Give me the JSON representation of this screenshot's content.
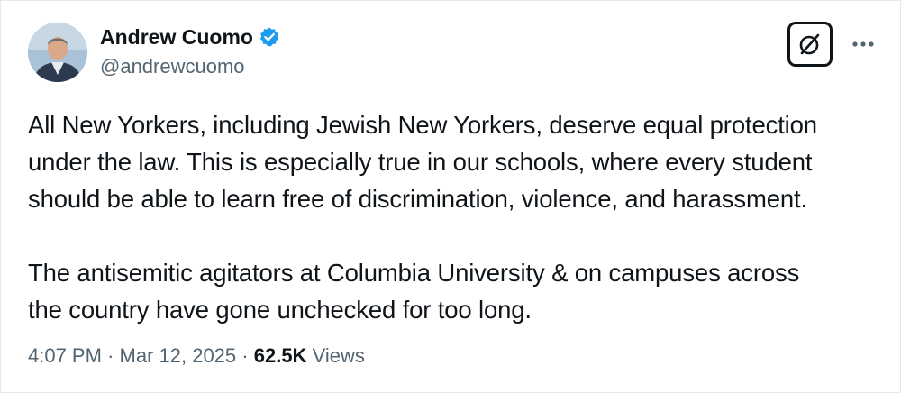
{
  "author": {
    "display_name": "Andrew Cuomo",
    "handle": "@andrewcuomo",
    "verified": true,
    "verified_color": "#1d9bf0"
  },
  "header_actions": {
    "grok_icon": "grok-icon",
    "more_icon": "more-options-icon"
  },
  "tweet": {
    "paragraphs": [
      "All New Yorkers, including Jewish New Yorkers, deserve equal protection\nunder the law. This is especially true in our schools, where every student\nshould be able to learn free of discrimination, violence, and harassment.",
      "The antisemitic agitators at Columbia University & on campuses across\nthe country have gone unchecked for too long."
    ]
  },
  "meta": {
    "time": "4:07 PM",
    "separator": "·",
    "date": "Mar 12, 2025",
    "views_count": "62.5K",
    "views_label": "Views"
  }
}
